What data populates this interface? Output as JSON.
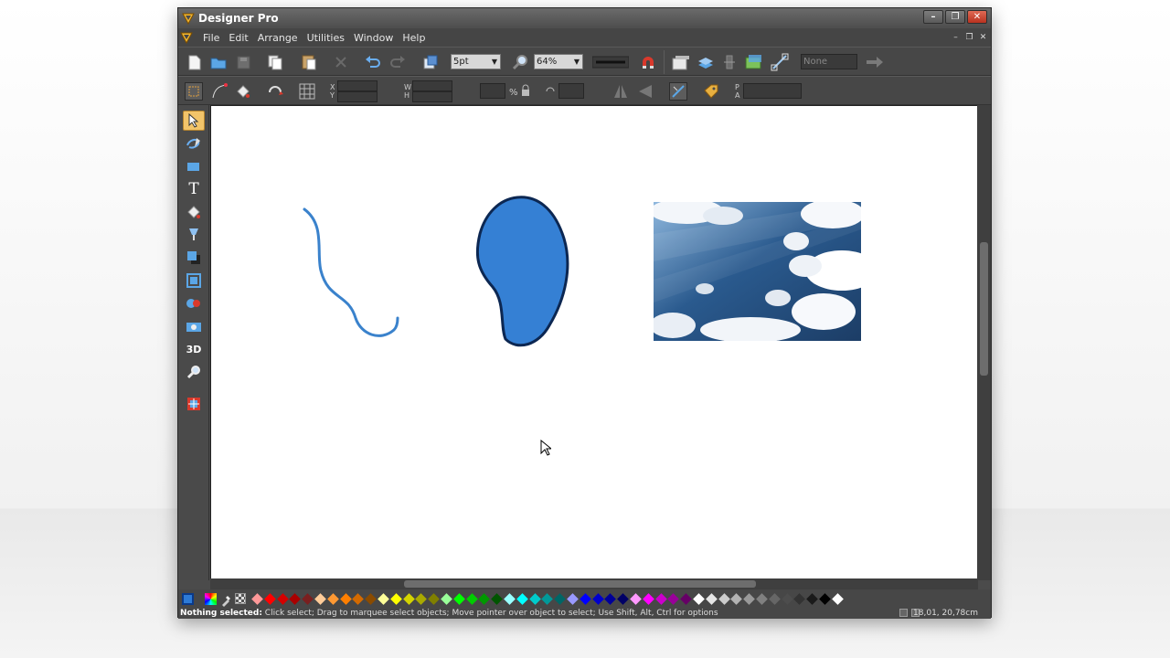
{
  "window": {
    "title": "Designer Pro",
    "controls": {
      "minimize": "–",
      "restore": "❐",
      "close": "✕"
    }
  },
  "menu": {
    "items": [
      "File",
      "Edit",
      "Arrange",
      "Utilities",
      "Window",
      "Help"
    ],
    "doc_controls": {
      "minimize": "–",
      "restore": "❐",
      "close": "✕"
    }
  },
  "toolbar": {
    "line_width": "5pt",
    "zoom": "64%",
    "name_field": "None"
  },
  "infobar": {
    "x_label": "X",
    "y_label": "Y",
    "w_label": "W",
    "h_label": "H",
    "p_label": "P",
    "a_label": "A"
  },
  "toolbox": {
    "text_tool_glyph": "T",
    "extrude_tool_label": "3D"
  },
  "canvas": {
    "objects": [
      "freehand-curve",
      "blue-blob-shape",
      "sky-photo"
    ]
  },
  "colors": {
    "accent": "#2d7ad6",
    "blob_fill": "#3580d4",
    "blob_stroke": "#0c2752",
    "curve_stroke": "#3a82cc",
    "palette": [
      "#ff9999",
      "#ff0000",
      "#d40000",
      "#aa0000",
      "#7a1f1f",
      "#ffcc99",
      "#ff9933",
      "#ff7f00",
      "#d46a00",
      "#8a4b00",
      "#ffff99",
      "#ffff00",
      "#d4d400",
      "#aaaa00",
      "#808000",
      "#99ff99",
      "#00ff00",
      "#00cc00",
      "#009900",
      "#005500",
      "#99ffff",
      "#00ffff",
      "#00cccc",
      "#009999",
      "#006666",
      "#9999ff",
      "#0000ff",
      "#0000cc",
      "#000099",
      "#000066",
      "#ff99ff",
      "#ff00ff",
      "#cc00cc",
      "#990099",
      "#660066",
      "#ffffff",
      "#e6e6e6",
      "#cccccc",
      "#b3b3b3",
      "#999999",
      "#808080",
      "#666666",
      "#4d4d4d",
      "#333333",
      "#1a1a1a",
      "#000000",
      "#ffffff"
    ]
  },
  "status": {
    "bold": "Nothing selected:",
    "text": " Click select; Drag to marquee select objects; Move pointer over object to select; Use Shift, Alt, Ctrl for options",
    "coords": "18,01, 20,78cm"
  }
}
